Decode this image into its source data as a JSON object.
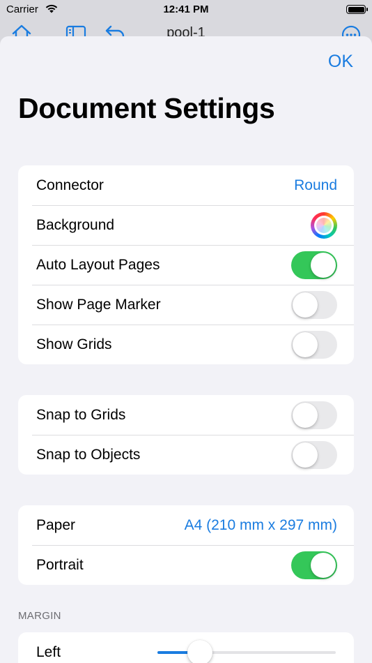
{
  "status_bar": {
    "carrier": "Carrier",
    "time": "12:41 PM"
  },
  "behind_nav": {
    "title": "pool-1"
  },
  "sheet": {
    "ok_label": "OK",
    "title": "Document Settings",
    "group1": {
      "connector": {
        "label": "Connector",
        "value": "Round"
      },
      "background": {
        "label": "Background"
      },
      "auto_layout": {
        "label": "Auto Layout Pages",
        "on": true
      },
      "page_marker": {
        "label": "Show Page Marker",
        "on": false
      },
      "show_grids": {
        "label": "Show Grids",
        "on": false
      }
    },
    "group2": {
      "snap_grids": {
        "label": "Snap to Grids",
        "on": false
      },
      "snap_objects": {
        "label": "Snap to Objects",
        "on": false
      }
    },
    "group3": {
      "paper": {
        "label": "Paper",
        "value": "A4 (210 mm x 297 mm)"
      },
      "portrait": {
        "label": "Portrait",
        "on": true
      }
    },
    "margin": {
      "header": "MARGIN",
      "left": {
        "label": "Left",
        "fraction": 0.24
      }
    }
  },
  "colors": {
    "accent": "#1a7ce0",
    "toggle_on": "#34c759",
    "sheet_bg": "#f2f2f7"
  }
}
